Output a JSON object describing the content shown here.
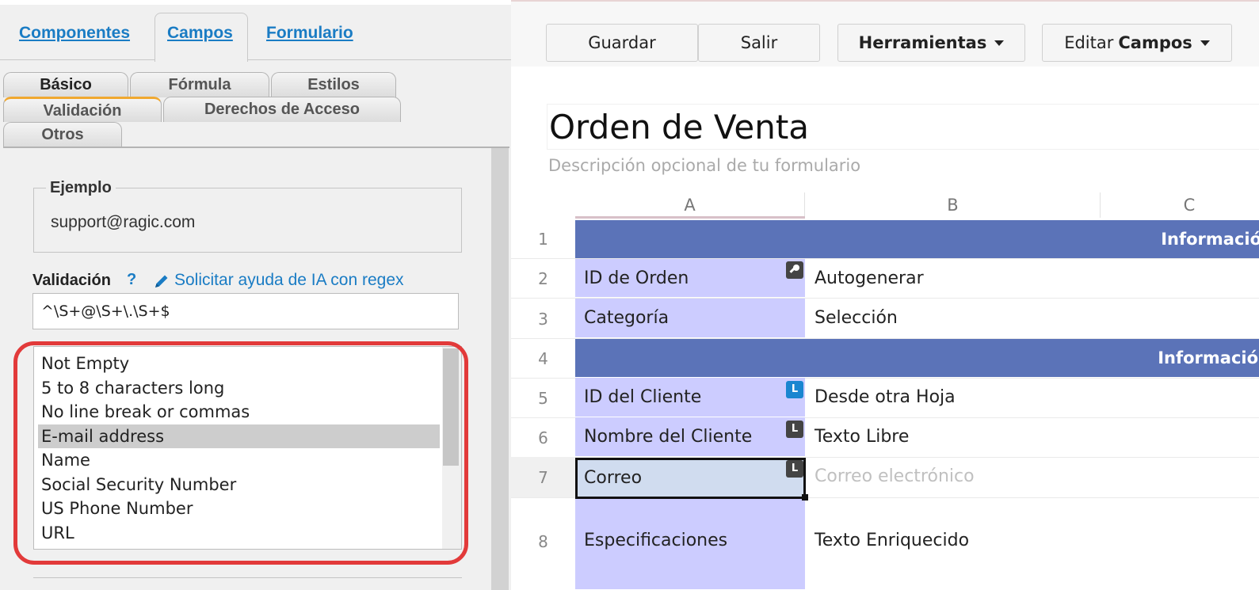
{
  "left_panel": {
    "main_tabs": [
      {
        "label": "Componentes"
      },
      {
        "label": "Campos"
      },
      {
        "label": "Formulario"
      }
    ],
    "sub_tabs": [
      {
        "label": "Básico"
      },
      {
        "label": "Fórmula"
      },
      {
        "label": "Estilos"
      },
      {
        "label": "Validación"
      },
      {
        "label": "Derechos de Acceso"
      },
      {
        "label": "Otros"
      }
    ],
    "example": {
      "legend": "Ejemplo",
      "value": "support@ragic.com"
    },
    "validation": {
      "label": "Validación",
      "help": "?",
      "ai_link": "Solicitar ayuda de IA con regex",
      "regex_value": "^\\S+@\\S+\\.\\S+$"
    },
    "presets": [
      {
        "label": "Not Empty"
      },
      {
        "label": "5 to 8 characters long"
      },
      {
        "label": "No line break or commas"
      },
      {
        "label": "E-mail address"
      },
      {
        "label": "Name"
      },
      {
        "label": "Social Security Number"
      },
      {
        "label": "US Phone Number"
      },
      {
        "label": "URL"
      }
    ],
    "selected_preset": "E-mail address",
    "highlight_color": "#e23a3a"
  },
  "toolbar": {
    "save_label": "Guardar",
    "exit_label": "Salir",
    "tools_label": "Herramientas",
    "edit_prefix": "Editar",
    "edit_bold": "Campos"
  },
  "form": {
    "title": "Orden de Venta",
    "description": "Descripción opcional de tu formulario",
    "columns": [
      "A",
      "B",
      "C"
    ],
    "section_color": "#5b73b8",
    "label_color": "#ccccff",
    "rows": [
      {
        "num": "1",
        "section": "Información"
      },
      {
        "num": "2",
        "label": "ID de Orden",
        "value": "Autogenerar",
        "badge": "key-icon"
      },
      {
        "num": "3",
        "label": "Categoría",
        "value": "Selección"
      },
      {
        "num": "4",
        "section": "Información"
      },
      {
        "num": "5",
        "label": "ID del Cliente",
        "value": "Desde otra Hoja",
        "badge": "L"
      },
      {
        "num": "6",
        "label": "Nombre del Cliente",
        "value": "Texto Libre",
        "badge": "L"
      },
      {
        "num": "7",
        "label": "Correo",
        "value": "Correo electrónico",
        "badge": "L"
      },
      {
        "num": "8",
        "label": "Especificaciones",
        "value": "Texto Enriquecido"
      }
    ]
  }
}
